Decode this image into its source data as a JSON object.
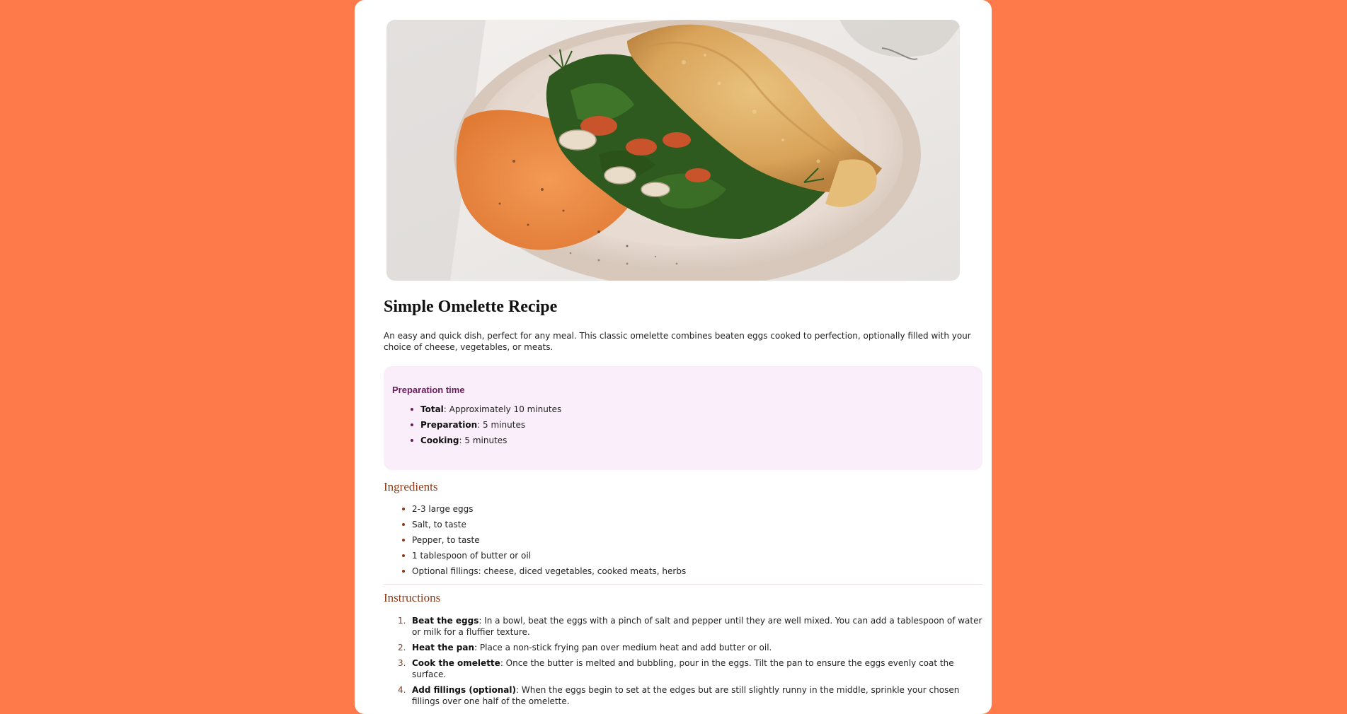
{
  "recipe": {
    "image_alt": "Omelette folded over spinach, mushrooms and dill with orange hummus on a cream plate",
    "title": "Simple Omelette Recipe",
    "intro": "An easy and quick dish, perfect for any meal. This classic omelette combines beaten eggs cooked to perfection, optionally filled with your choice of cheese, vegetables, or meats."
  },
  "preparation": {
    "title": "Preparation time",
    "items": [
      {
        "label": "Total",
        "value": ": Approximately 10 minutes"
      },
      {
        "label": "Preparation",
        "value": ": 5 minutes"
      },
      {
        "label": "Cooking",
        "value": ": 5 minutes"
      }
    ]
  },
  "ingredients": {
    "title": "Ingredients",
    "items": [
      "2-3 large eggs",
      "Salt, to taste",
      "Pepper, to taste",
      "1 tablespoon of butter or oil",
      "Optional fillings: cheese, diced vegetables, cooked meats, herbs"
    ]
  },
  "instructions": {
    "title": "Instructions",
    "steps": [
      {
        "label": "Beat the eggs",
        "text": ": In a bowl, beat the eggs with a pinch of salt and pepper until they are well mixed. You can add a tablespoon of water or milk for a fluffier texture."
      },
      {
        "label": "Heat the pan",
        "text": ": Place a non-stick frying pan over medium heat and add butter or oil."
      },
      {
        "label": "Cook the omelette",
        "text": ": Once the butter is melted and bubbling, pour in the eggs. Tilt the pan to ensure the eggs evenly coat the surface."
      },
      {
        "label": "Add fillings (optional)",
        "text": ": When the eggs begin to set at the edges but are still slightly runny in the middle, sprinkle your chosen fillings over one half of the omelette."
      }
    ]
  },
  "colors": {
    "page_background": "#FF7A4A",
    "card_background": "#FFFFFF",
    "prep_background": "#FBEEFB",
    "prep_accent": "#6B1D5C",
    "heading_accent": "#8E3A16"
  }
}
